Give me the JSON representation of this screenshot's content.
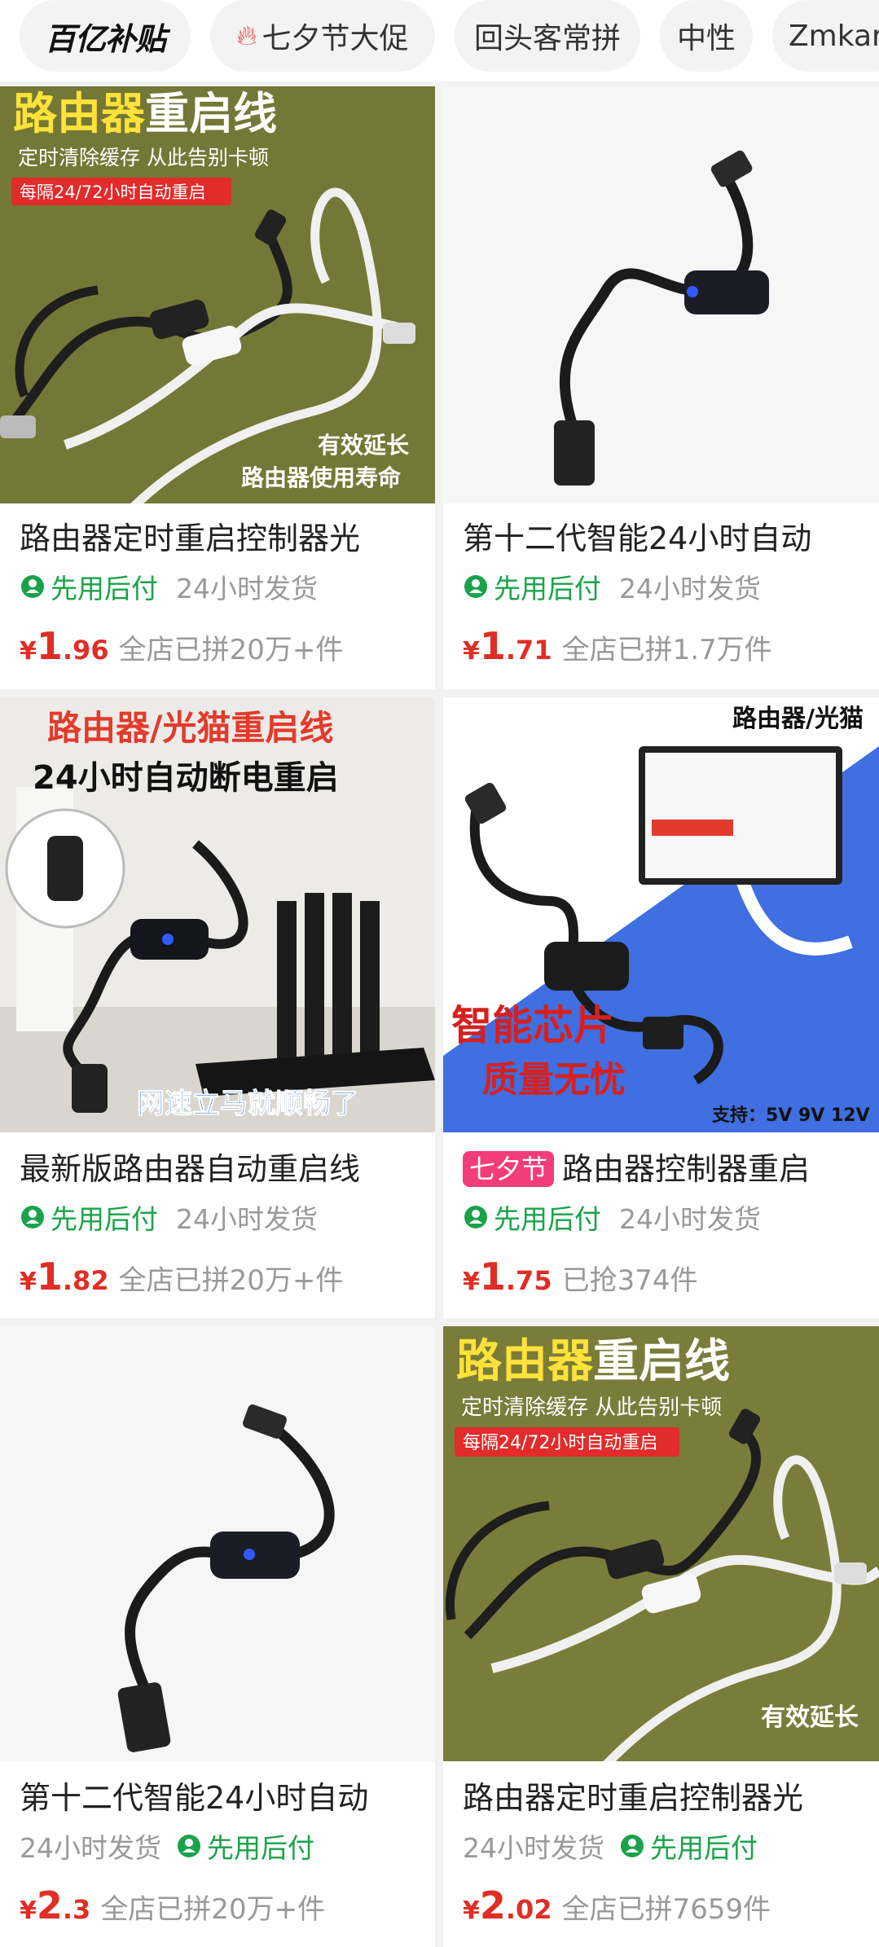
{
  "tabs": [
    {
      "label": "百亿补贴",
      "kind": "logo"
    },
    {
      "label": "七夕节大促",
      "kind": "fire"
    },
    {
      "label": "回头客常拼",
      "kind": "plain"
    },
    {
      "label": "中性",
      "kind": "plain"
    },
    {
      "label": "Zmkar",
      "kind": "plain"
    }
  ],
  "products": [
    {
      "title": "路由器定时重启控制器光",
      "pay_label": "先用后付",
      "ship": "24小时发货",
      "pay_first": true,
      "price_int": "1",
      "price_dec": ".96",
      "currency": "¥",
      "sold": "全店已拼20万+件",
      "img_text": {
        "headline_a": "路由器",
        "headline_b": "重启线",
        "sub": "定时清除缓存 从此告别卡顿",
        "badge": "每隔24/72小时自动重启",
        "foot1": "有效延长",
        "foot2": "路由器使用寿命"
      }
    },
    {
      "title": "第十二代智能24小时自动",
      "pay_label": "先用后付",
      "ship": "24小时发货",
      "pay_first": true,
      "price_int": "1",
      "price_dec": ".71",
      "currency": "¥",
      "sold": "全店已拼1.7万件"
    },
    {
      "title": "最新版路由器自动重启线",
      "pay_label": "先用后付",
      "ship": "24小时发货",
      "pay_first": true,
      "price_int": "1",
      "price_dec": ".82",
      "currency": "¥",
      "sold": "全店已拼20万+件",
      "img_text": {
        "headline": "路由器/光猫重启线",
        "sub": "24小时自动断电重启",
        "foot": "网速立马就顺畅了"
      }
    },
    {
      "festival": "七夕节",
      "title": "路由器控制器重启",
      "pay_label": "先用后付",
      "ship": "24小时发货",
      "pay_first": true,
      "price_int": "1",
      "price_dec": ".75",
      "currency": "¥",
      "sold": "已抢374件",
      "img_text": {
        "corner": "路由器/光猫",
        "big1": "智能芯片",
        "big2": "质量无忧",
        "support": "支持：5V 9V 12V"
      }
    },
    {
      "title": "第十二代智能24小时自动",
      "pay_label": "先用后付",
      "ship": "24小时发货",
      "pay_first": false,
      "price_int": "2",
      "price_dec": ".3",
      "currency": "¥",
      "sold": "全店已拼20万+件"
    },
    {
      "title": "路由器定时重启控制器光",
      "pay_label": "先用后付",
      "ship": "24小时发货",
      "pay_first": false,
      "price_int": "2",
      "price_dec": ".02",
      "currency": "¥",
      "sold": "全店已拼7659件",
      "img_text": {
        "headline_a": "路由器",
        "headline_b": "重启线",
        "sub": "定时清除缓存 从此告别卡顿",
        "badge": "每隔24/72小时自动重启",
        "foot1": "有效延长"
      }
    }
  ],
  "colors": {
    "price": "#e02e24",
    "pay": "#1aa34a",
    "festival": "#f23d7a",
    "muted": "#999999"
  }
}
